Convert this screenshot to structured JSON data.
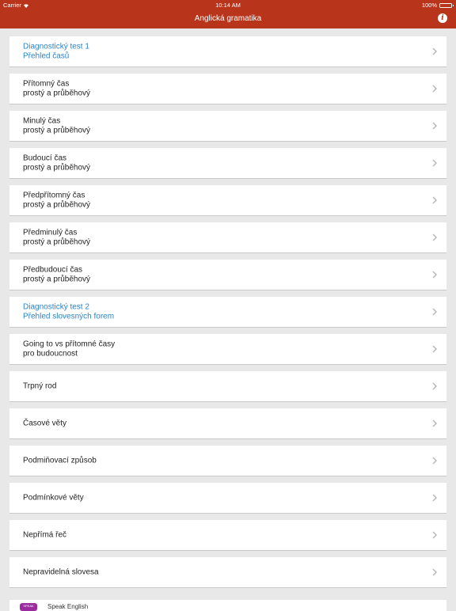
{
  "status_bar": {
    "carrier": "Carrier",
    "time": "10:14 AM",
    "battery": "100%"
  },
  "nav": {
    "title": "Anglická gramatika",
    "info_icon": "info-icon",
    "info_glyph": "i"
  },
  "colors": {
    "brand": "#b8341b",
    "accent_text": "#2b84c8"
  },
  "menu": [
    {
      "line1": "Diagnostický test 1",
      "line2": "Přehled časů",
      "accent": true
    },
    {
      "line1": "Přítomný čas",
      "line2": "prostý a průběhový",
      "accent": false
    },
    {
      "line1": "Minulý čas",
      "line2": "prostý a průběhový",
      "accent": false
    },
    {
      "line1": "Budoucí čas",
      "line2": "prostý a průběhový",
      "accent": false
    },
    {
      "line1": "Předpřítomný čas",
      "line2": "prostý a průběhový",
      "accent": false
    },
    {
      "line1": "Předminulý čas",
      "line2": "prostý a průběhový",
      "accent": false
    },
    {
      "line1": "Předbudoucí čas",
      "line2": "prostý a průběhový",
      "accent": false
    },
    {
      "line1": "Diagnostický test 2",
      "line2": "Přehled slovesných forem",
      "accent": true
    },
    {
      "line1": "Going to vs přítomné časy",
      "line2": "pro budoucnost",
      "accent": false
    },
    {
      "line1": "Trpný rod",
      "line2": "",
      "accent": false
    },
    {
      "line1": "Časové věty",
      "line2": "",
      "accent": false
    },
    {
      "line1": "Podmiňovací způsob",
      "line2": "",
      "accent": false
    },
    {
      "line1": "Podmínkové věty",
      "line2": "",
      "accent": false
    },
    {
      "line1": "Nepřímá řeč",
      "line2": "",
      "accent": false
    },
    {
      "line1": "Nepravidelná slovesa",
      "line2": "",
      "accent": false
    }
  ],
  "promo": {
    "icon_label": "SPEAK",
    "name": "Speak English"
  }
}
